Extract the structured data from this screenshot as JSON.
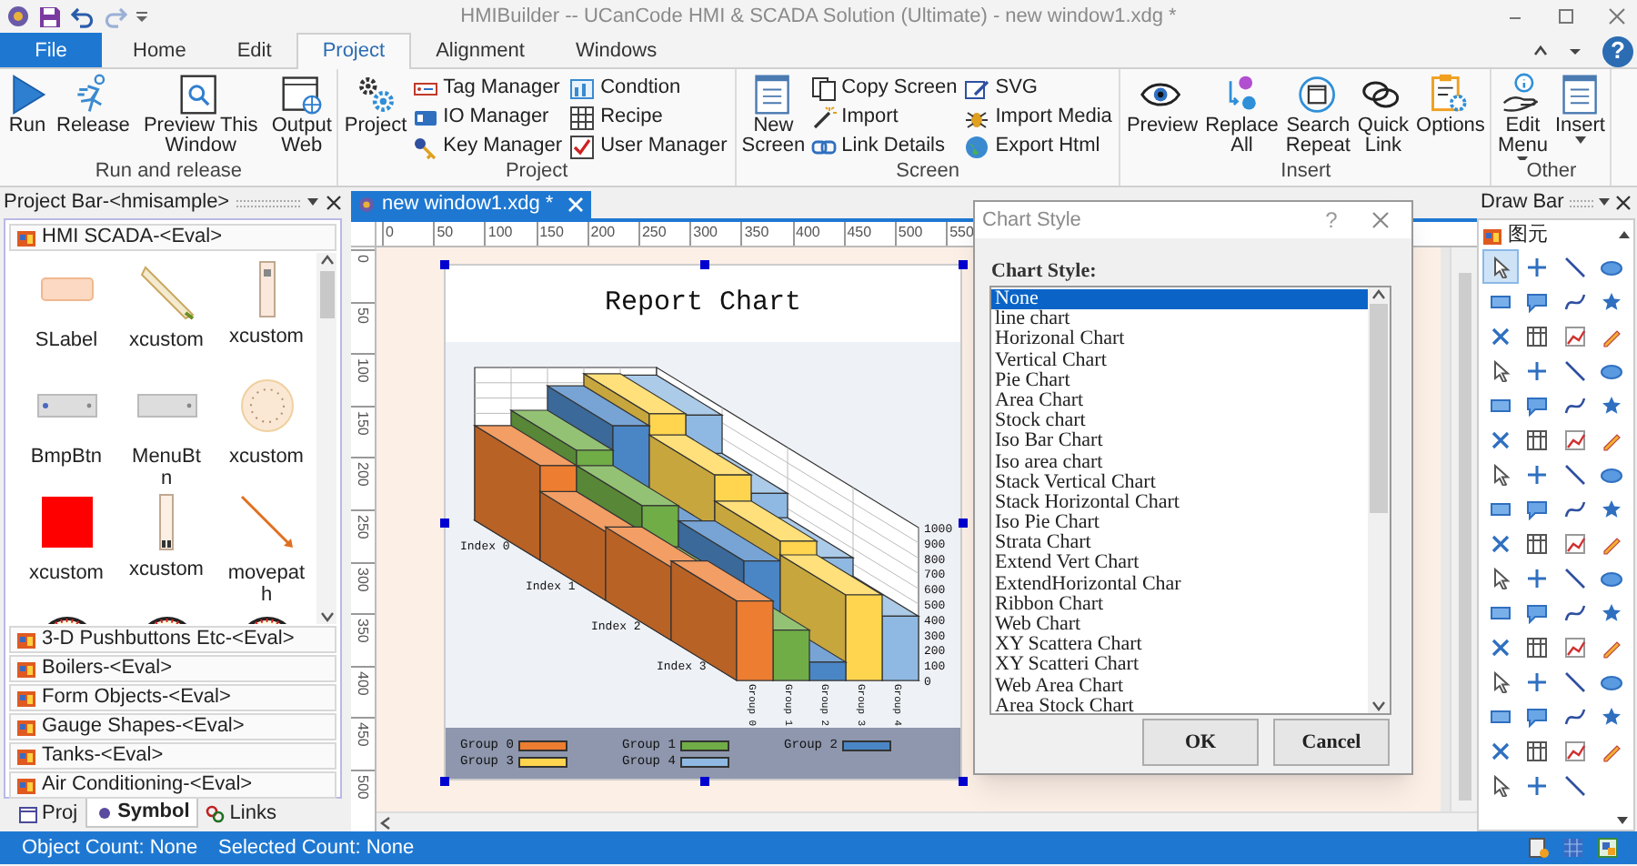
{
  "window": {
    "title": "HMIBuilder -- UCanCode HMI & SCADA Solution (Ultimate) - new window1.xdg *"
  },
  "ribbon_tabs": [
    {
      "label": "File",
      "kind": "file",
      "selected": false
    },
    {
      "label": "Home",
      "kind": "tab",
      "selected": false
    },
    {
      "label": "Edit",
      "kind": "tab",
      "selected": false
    },
    {
      "label": "Project",
      "kind": "tab",
      "selected": true
    },
    {
      "label": "Alignment",
      "kind": "tab",
      "selected": false
    },
    {
      "label": "Windows",
      "kind": "tab",
      "selected": false
    }
  ],
  "help_label": "?",
  "ribbon_groups": [
    {
      "label": "Run and release",
      "items": [
        {
          "label": "Run",
          "kind": "large"
        },
        {
          "label": "Release",
          "kind": "large"
        },
        {
          "label": "Preview This Window",
          "kind": "large"
        },
        {
          "label": "Output Web",
          "kind": "large"
        }
      ]
    },
    {
      "label": "Project",
      "items": [
        {
          "label": "Project",
          "kind": "large"
        },
        {
          "label": "Tag Manager",
          "kind": "small"
        },
        {
          "label": "IO Manager",
          "kind": "small"
        },
        {
          "label": "Key Manager",
          "kind": "small"
        },
        {
          "label": "Condtion",
          "kind": "small"
        },
        {
          "label": "Recipe",
          "kind": "small"
        },
        {
          "label": "User Manager",
          "kind": "small"
        }
      ]
    },
    {
      "label": "Screen",
      "items": [
        {
          "label": "New Screen",
          "kind": "large"
        },
        {
          "label": "Copy Screen",
          "kind": "small"
        },
        {
          "label": "Import",
          "kind": "small"
        },
        {
          "label": "Link Details",
          "kind": "small"
        },
        {
          "label": "SVG",
          "kind": "small"
        },
        {
          "label": "Import Media",
          "kind": "small"
        },
        {
          "label": "Export Html",
          "kind": "small"
        }
      ]
    },
    {
      "label": "Insert",
      "items": [
        {
          "label": "Preview",
          "kind": "large"
        },
        {
          "label": "Replace All",
          "kind": "large"
        },
        {
          "label": "Search Repeat",
          "kind": "large"
        },
        {
          "label": "Quick Link",
          "kind": "large"
        },
        {
          "label": "Options",
          "kind": "large"
        }
      ]
    },
    {
      "label": "Other",
      "items": [
        {
          "label": "Edit Menu",
          "kind": "large",
          "dropdown": true
        },
        {
          "label": "Insert",
          "kind": "large",
          "dropdown": true
        }
      ]
    }
  ],
  "project_bar": {
    "title": "Project Bar-<hmisample>",
    "categories": [
      {
        "label": "HMI SCADA-<Eval>",
        "symbols": [
          {
            "label": "SLabel"
          },
          {
            "label": "xcustom"
          },
          {
            "label": "xcustom"
          },
          {
            "label": "BmpBtn"
          },
          {
            "label": "MenuBtn"
          },
          {
            "label": "xcustom"
          },
          {
            "label": "xcustom"
          },
          {
            "label": "xcustom"
          },
          {
            "label": "movepath"
          }
        ]
      },
      {
        "label": "3-D Pushbuttons Etc-<Eval>"
      },
      {
        "label": "Boilers-<Eval>"
      },
      {
        "label": "Form Objects-<Eval>"
      },
      {
        "label": "Gauge Shapes-<Eval>"
      },
      {
        "label": "Tanks-<Eval>"
      },
      {
        "label": "Air Conditioning-<Eval>"
      }
    ],
    "tabs": [
      {
        "label": "Proj",
        "selected": false
      },
      {
        "label": "Symbol",
        "selected": true
      },
      {
        "label": "Links",
        "selected": false
      }
    ]
  },
  "doc_tabs": [
    {
      "label": "new window1.xdg *",
      "selected": true
    }
  ],
  "ruler": {
    "horizontal": [
      "0",
      "50",
      "100",
      "150",
      "200",
      "250",
      "300",
      "350",
      "400",
      "450",
      "500",
      "550"
    ],
    "vertical": [
      "0",
      "50",
      "100",
      "150",
      "200",
      "250",
      "300",
      "350",
      "400",
      "450",
      "500"
    ]
  },
  "report_chart": {
    "title": "Report Chart",
    "index_labels": [
      "Index 0",
      "Index 1",
      "Index 2",
      "Index 3"
    ],
    "group_labels": [
      "Group 0",
      "Group 1",
      "Group 2",
      "Group 3",
      "Group 4"
    ],
    "axis_ticks": [
      "1000",
      "900",
      "800",
      "700",
      "600",
      "500",
      "400",
      "300",
      "200",
      "100",
      "0"
    ],
    "legend": [
      {
        "label": "Group 0",
        "color": "#ed7d31"
      },
      {
        "label": "Group 1",
        "color": "#70ad47"
      },
      {
        "label": "Group 2",
        "color": "#4a86c5"
      },
      {
        "label": "Group 3",
        "color": "#ffd54f"
      },
      {
        "label": "Group 4",
        "color": "#8fb9e2"
      }
    ]
  },
  "dialog": {
    "title": "Chart Style",
    "help": "?",
    "label": "Chart Style:",
    "options": [
      {
        "label": "None",
        "selected": true
      },
      {
        "label": "line chart",
        "selected": false
      },
      {
        "label": "Horizonal Chart",
        "selected": false
      },
      {
        "label": "Vertical Chart",
        "selected": false
      },
      {
        "label": "Pie Chart",
        "selected": false
      },
      {
        "label": "Area Chart",
        "selected": false
      },
      {
        "label": "Stock chart",
        "selected": false
      },
      {
        "label": "Iso Bar Chart",
        "selected": false
      },
      {
        "label": "Iso area chart",
        "selected": false
      },
      {
        "label": "Stack Vertical Chart",
        "selected": false
      },
      {
        "label": "Stack Horizontal Chart",
        "selected": false
      },
      {
        "label": "Iso Pie Chart",
        "selected": false
      },
      {
        "label": "Strata Chart",
        "selected": false
      },
      {
        "label": "Extend Vert Chart",
        "selected": false
      },
      {
        "label": "ExtendHorizontal Char",
        "selected": false
      },
      {
        "label": "Ribbon Chart",
        "selected": false
      },
      {
        "label": "Web Chart",
        "selected": false
      },
      {
        "label": "XY Scattera Chart",
        "selected": false
      },
      {
        "label": "XY Scatteri Chart",
        "selected": false
      },
      {
        "label": "Web Area Chart",
        "selected": false
      },
      {
        "label": "Area Stock Chart",
        "selected": false
      }
    ],
    "buttons": [
      "OK",
      "Cancel"
    ]
  },
  "draw_bar": {
    "title": "Draw Bar",
    "category": "图元",
    "tools": [
      {
        "selected": true
      },
      {
        "selected": false
      },
      {
        "selected": false
      },
      {
        "selected": false
      },
      {
        "selected": false
      },
      {
        "selected": false
      },
      {
        "selected": false
      },
      {
        "selected": false
      },
      {
        "selected": false
      },
      {
        "selected": false
      },
      {
        "selected": false
      },
      {
        "selected": false
      },
      {
        "selected": false
      },
      {
        "selected": false
      },
      {
        "selected": false
      },
      {
        "selected": false
      },
      {
        "selected": false
      },
      {
        "selected": false
      },
      {
        "selected": false
      },
      {
        "selected": false
      },
      {
        "selected": false
      },
      {
        "selected": false
      },
      {
        "selected": false
      },
      {
        "selected": false
      },
      {
        "selected": false
      },
      {
        "selected": false
      },
      {
        "selected": false
      },
      {
        "selected": false
      },
      {
        "selected": false
      },
      {
        "selected": false
      },
      {
        "selected": false
      },
      {
        "selected": false
      },
      {
        "selected": false
      },
      {
        "selected": false
      },
      {
        "selected": false
      },
      {
        "selected": false
      },
      {
        "selected": false
      },
      {
        "selected": false
      },
      {
        "selected": false
      },
      {
        "selected": false
      },
      {
        "selected": false
      },
      {
        "selected": false
      },
      {
        "selected": false
      },
      {
        "selected": false
      },
      {
        "selected": false
      },
      {
        "selected": false
      },
      {
        "selected": false
      },
      {
        "selected": false
      },
      {
        "selected": false
      },
      {
        "selected": false
      },
      {
        "selected": false
      },
      {
        "selected": false
      },
      {
        "selected": false
      },
      {
        "selected": false
      },
      {
        "selected": false
      },
      {
        "selected": false
      },
      {
        "selected": false
      },
      {
        "selected": false
      },
      {
        "selected": false
      },
      {
        "selected": false
      },
      {
        "selected": false
      },
      {
        "selected": false
      },
      {
        "selected": false
      }
    ]
  },
  "status_bar": {
    "object_count": "Object Count: None",
    "selected_count": "Selected Count: None"
  }
}
